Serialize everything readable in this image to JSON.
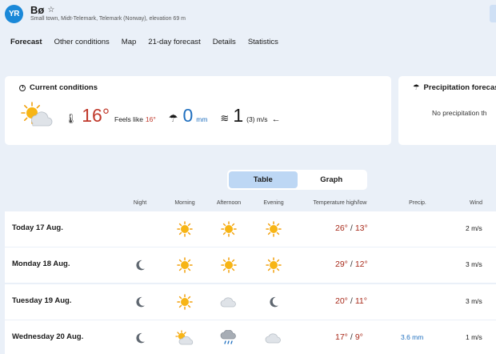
{
  "app": {
    "logo_text": "YR"
  },
  "location": {
    "name": "Bø",
    "subtitle": "Small town, Midt-Telemark, Telemark (Norway), elevation 69 m"
  },
  "nav": {
    "items": [
      "Forecast",
      "Other conditions",
      "Map",
      "21-day forecast",
      "Details",
      "Statistics"
    ],
    "active": "Forecast"
  },
  "current": {
    "title": "Current conditions",
    "icon": "partly-cloudy-sun-icon",
    "temperature": "16°",
    "feels_like_label": "Feels like",
    "feels_like_value": "16°",
    "precipitation": "0",
    "precipitation_unit": "mm",
    "wind": "1",
    "wind_unit": "(3) m/s",
    "wind_arrow": "←"
  },
  "precip_forecast": {
    "title": "Precipitation forecas",
    "note": "No precipitation th"
  },
  "view_toggle": {
    "table": "Table",
    "graph": "Graph",
    "selected": "Table"
  },
  "table": {
    "headers": {
      "night": "Night",
      "morning": "Morning",
      "afternoon": "Afternoon",
      "evening": "Evening",
      "temp": "Temperature high/low",
      "precip": "Precip.",
      "wind": "Wind"
    },
    "rows": [
      {
        "day": "Today 17 Aug.",
        "night": "",
        "morning": "sun",
        "afternoon": "sun",
        "evening": "sun",
        "high": "26°",
        "low": "13°",
        "precip": "",
        "wind": "2 m/s"
      },
      {
        "day": "Monday 18 Aug.",
        "night": "moon",
        "morning": "sun",
        "afternoon": "sun",
        "evening": "sun",
        "high": "29°",
        "low": "12°",
        "precip": "",
        "wind": "3 m/s"
      },
      {
        "day": "Tuesday 19 Aug.",
        "night": "moon",
        "morning": "sun",
        "afternoon": "cloud",
        "evening": "moon",
        "high": "20°",
        "low": "11°",
        "precip": "",
        "wind": "3 m/s"
      },
      {
        "day": "Wednesday 20 Aug.",
        "night": "moon",
        "morning": "partly",
        "afternoon": "rain",
        "evening": "cloud",
        "high": "17°",
        "low": "9°",
        "precip": "3.6 mm",
        "wind": "1 m/s"
      }
    ]
  },
  "colors": {
    "accent": "#1a88d8",
    "temp_warm": "#c0392b",
    "precip_blue": "#1f6fbf",
    "background": "#eaf0f8",
    "toggle_selected": "#bdd7f4"
  }
}
